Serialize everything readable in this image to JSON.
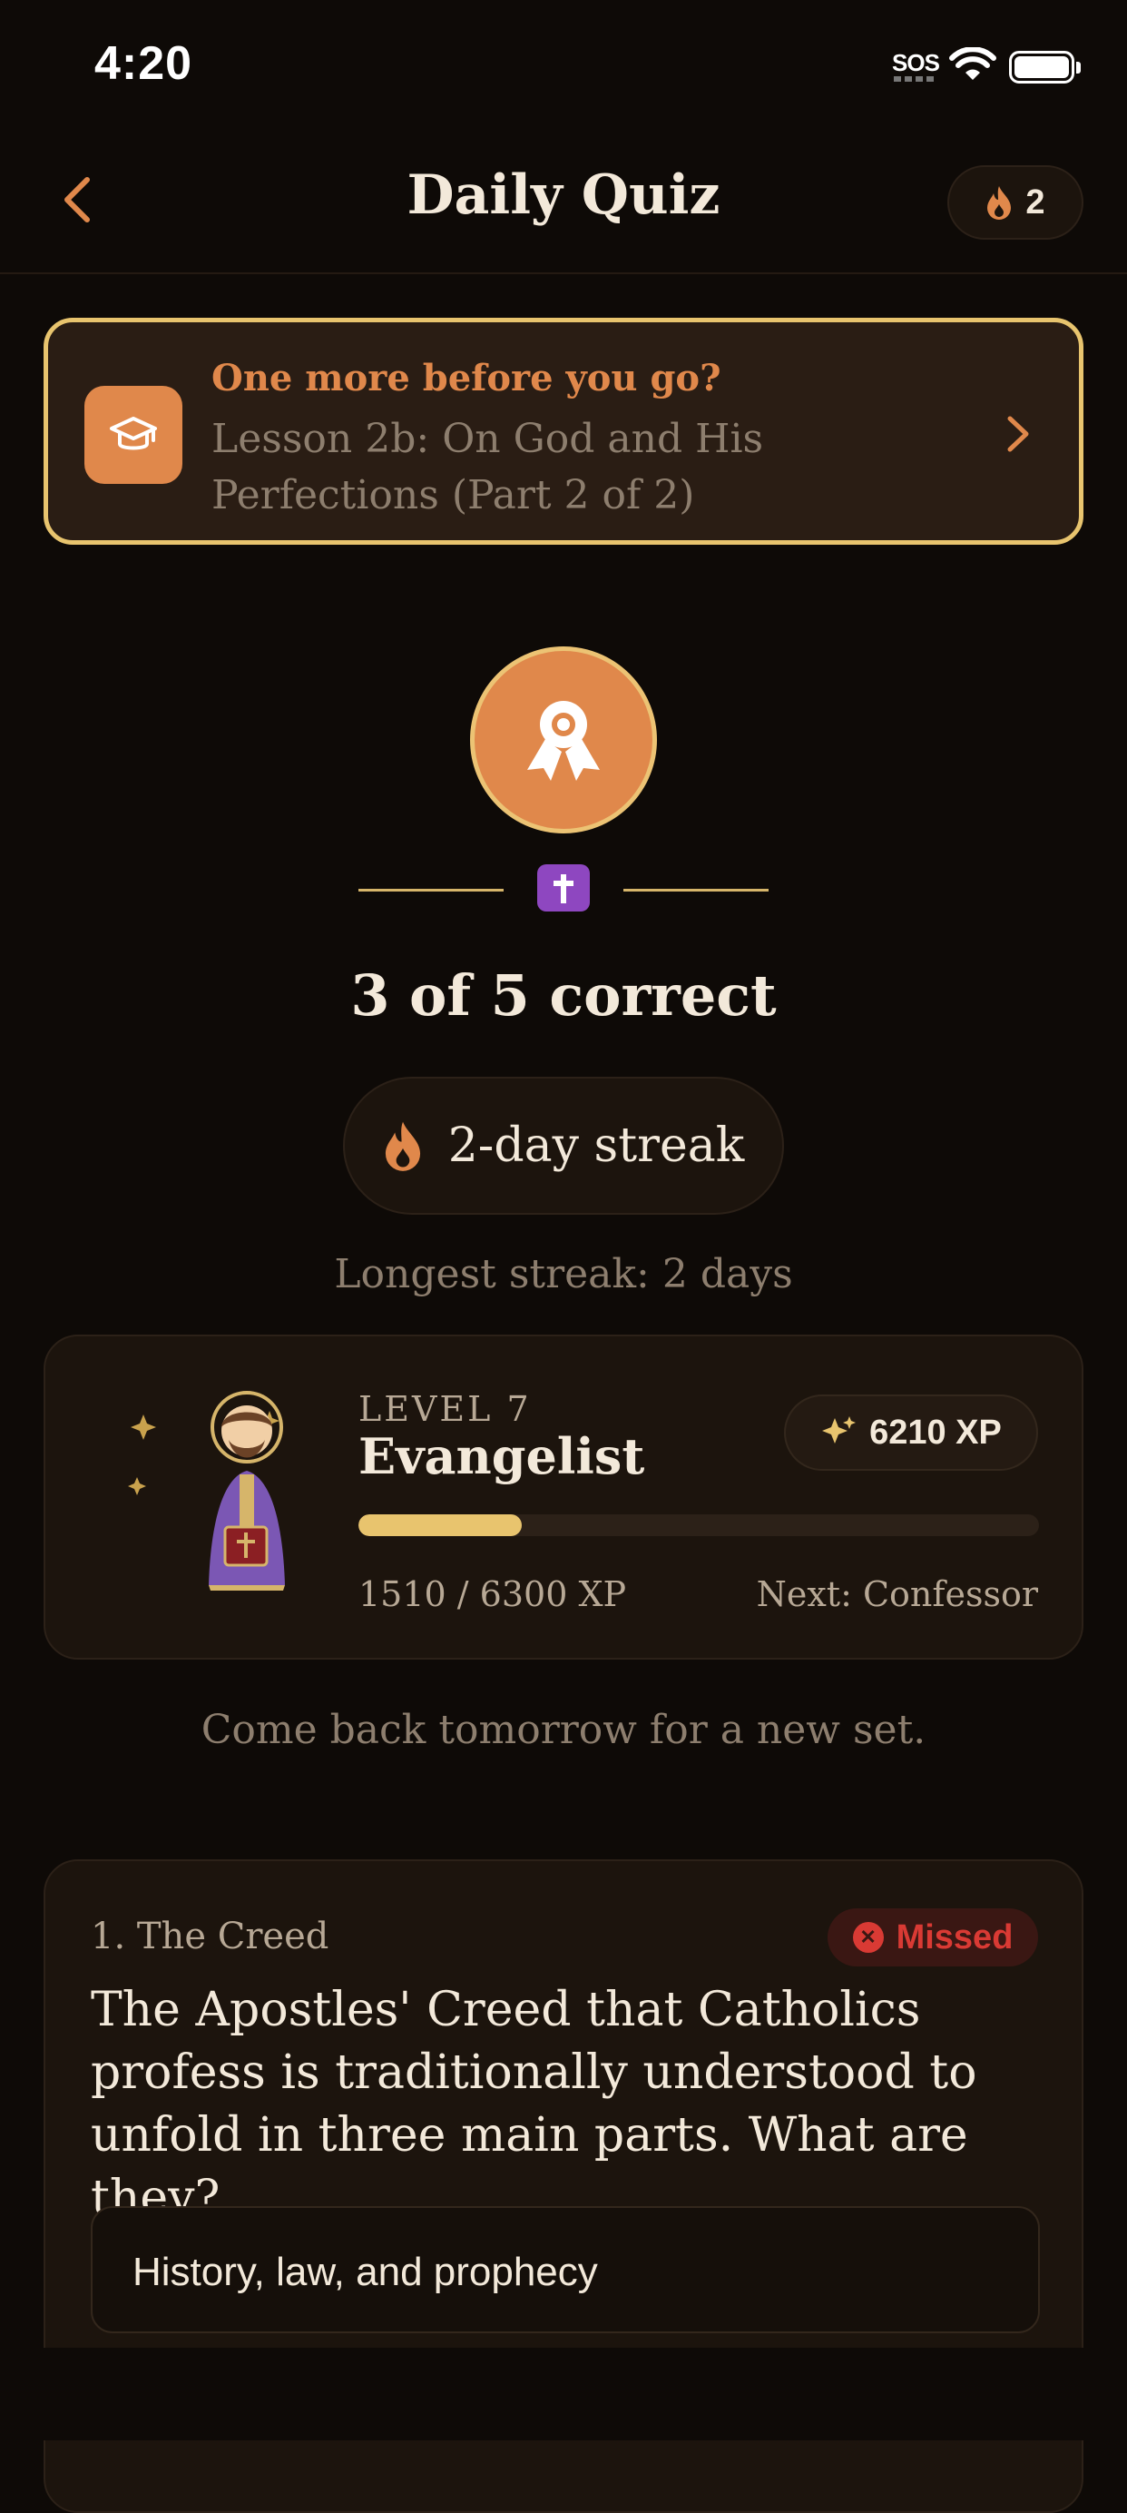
{
  "status_bar": {
    "time": "4:20",
    "sos": "SOS"
  },
  "header": {
    "title": "Daily Quiz",
    "streak_count": "2"
  },
  "lesson_prompt": {
    "heading": "One more before you go?",
    "subtitle": "Lesson 2b: On God and His Perfections (Part 2 of 2)"
  },
  "result": {
    "score": "3 of 5 correct",
    "streak_label": "2-day streak",
    "longest_streak": "Longest streak: 2 days"
  },
  "level": {
    "label": "LEVEL 7",
    "name": "Evangelist",
    "xp_total": "6210 XP",
    "progress_text": "1510 / 6300 XP",
    "progress_fraction": 0.24,
    "next": "Next: Confessor"
  },
  "come_back": "Come back tomorrow for a new set.",
  "question": {
    "category": "1. The Creed",
    "status": "Missed",
    "text": "The Apostles' Creed that Catholics profess is traditionally understood to unfold in three main parts. What are they?",
    "answer": "History, law, and prophecy"
  },
  "colors": {
    "accent": "#e0884b",
    "gold": "#e8c46e",
    "background": "#0e0a07",
    "card": "#1c140d",
    "missed": "#d93a34"
  },
  "icons": {
    "back": "chevron-left-icon",
    "streak": "flame-icon",
    "lesson": "graduation-cap-icon",
    "lesson_go": "chevron-right-icon",
    "medal": "award-icon",
    "cross": "cross-icon",
    "xp": "sparkles-icon",
    "missed": "x-circle-icon"
  }
}
